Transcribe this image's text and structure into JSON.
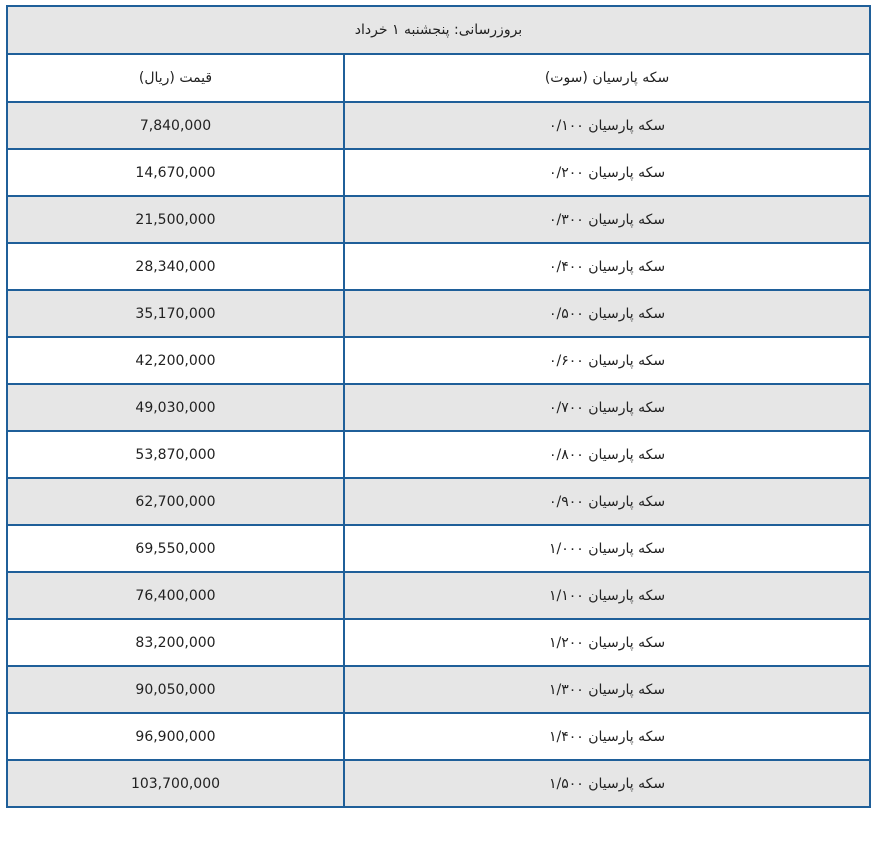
{
  "update_label": "بروزرسانی: پنجشنبه ۱ خرداد",
  "headers": {
    "name": "سکه پارسیان (سوت)",
    "price": "قیمت (ریال)"
  },
  "rows": [
    {
      "name": "سکه پارسیان ۰/۱۰۰",
      "price": "7,840,000"
    },
    {
      "name": "سکه پارسیان ۰/۲۰۰",
      "price": "14,670,000"
    },
    {
      "name": "سکه پارسیان ۰/۳۰۰",
      "price": "21,500,000"
    },
    {
      "name": "سکه پارسیان ۰/۴۰۰",
      "price": "28,340,000"
    },
    {
      "name": "سکه پارسیان ۰/۵۰۰",
      "price": "35,170,000"
    },
    {
      "name": "سکه پارسیان ۰/۶۰۰",
      "price": "42,200,000"
    },
    {
      "name": "سکه پارسیان ۰/۷۰۰",
      "price": "49,030,000"
    },
    {
      "name": "سکه پارسیان ۰/۸۰۰",
      "price": "53,870,000"
    },
    {
      "name": "سکه پارسیان ۰/۹۰۰",
      "price": "62,700,000"
    },
    {
      "name": "سکه پارسیان ۱/۰۰۰",
      "price": "69,550,000"
    },
    {
      "name": "سکه پارسیان ۱/۱۰۰",
      "price": "76,400,000"
    },
    {
      "name": "سکه پارسیان ۱/۲۰۰",
      "price": "83,200,000"
    },
    {
      "name": "سکه پارسیان ۱/۳۰۰",
      "price": "90,050,000"
    },
    {
      "name": "سکه پارسیان ۱/۴۰۰",
      "price": "96,900,000"
    },
    {
      "name": "سکه پارسیان ۱/۵۰۰",
      "price": "103,700,000"
    }
  ],
  "colors": {
    "border": "#1f5f99",
    "shade": "#e6e6e6",
    "plain": "#ffffff",
    "text": "#222222"
  }
}
